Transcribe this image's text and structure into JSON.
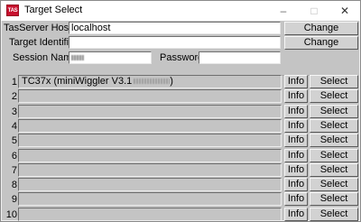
{
  "window": {
    "title": "Target Select",
    "icon_label": "TAS",
    "minimize_glyph": "–",
    "maximize_glyph": "□",
    "close_glyph": "✕"
  },
  "form": {
    "host_label": "TasServer Host:",
    "host_value": "localhost",
    "target_id_label": "Target Identifier",
    "target_id_value": "",
    "session_label": "Session Name",
    "password_label": "Password",
    "password_value": "",
    "change_label": "Change"
  },
  "targets": [
    {
      "index": "1",
      "text_prefix": "TC37x (miniWiggler V3.1",
      "text_suffix": ")",
      "info": "Info",
      "select": "Select"
    },
    {
      "index": "2",
      "text_prefix": "",
      "text_suffix": "",
      "info": "Info",
      "select": "Select"
    },
    {
      "index": "3",
      "text_prefix": "",
      "text_suffix": "",
      "info": "Info",
      "select": "Select"
    },
    {
      "index": "4",
      "text_prefix": "",
      "text_suffix": "",
      "info": "Info",
      "select": "Select"
    },
    {
      "index": "5",
      "text_prefix": "",
      "text_suffix": "",
      "info": "Info",
      "select": "Select"
    },
    {
      "index": "6",
      "text_prefix": "",
      "text_suffix": "",
      "info": "Info",
      "select": "Select"
    },
    {
      "index": "7",
      "text_prefix": "",
      "text_suffix": "",
      "info": "Info",
      "select": "Select"
    },
    {
      "index": "8",
      "text_prefix": "",
      "text_suffix": "",
      "info": "Info",
      "select": "Select"
    },
    {
      "index": "9",
      "text_prefix": "",
      "text_suffix": "",
      "info": "Info",
      "select": "Select"
    },
    {
      "index": "10",
      "text_prefix": "",
      "text_suffix": "",
      "info": "Info",
      "select": "Select"
    }
  ],
  "colors": {
    "client_bg": "#c4c4c4",
    "icon_red": "#c8102e"
  }
}
